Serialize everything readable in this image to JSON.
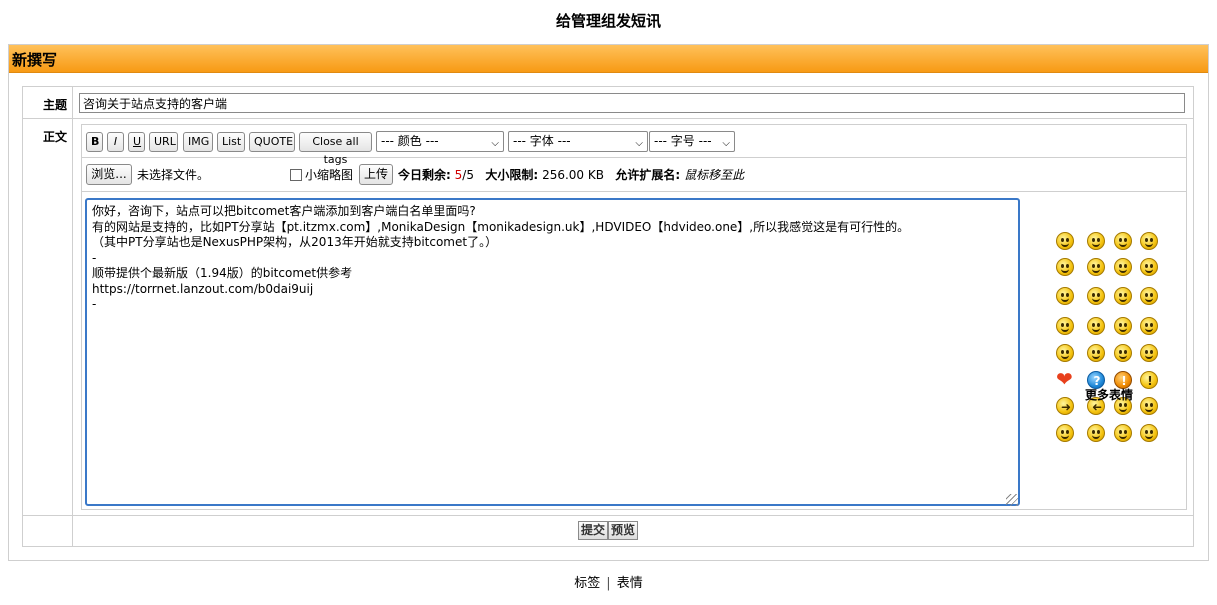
{
  "page_title": "给管理组发短讯",
  "section_header": "新撰写",
  "subject": {
    "label": "主题",
    "value": "咨询关于站点支持的客户端"
  },
  "body_label": "正文",
  "toolbar": {
    "bold": "B",
    "italic": "I",
    "underline": "U",
    "url": "URL",
    "img": "IMG",
    "list": "List",
    "quote": "QUOTE",
    "close_all_tags": "Close all tags",
    "color_select": "--- 颜色 ---",
    "font_select": "--- 字体 ---",
    "size_select": "--- 字号 ---"
  },
  "upload": {
    "browse_label": "浏览...",
    "no_file": "未选择文件。",
    "thumbnail_label": "小缩略图",
    "upload_label": "上传",
    "today_left_label": "今日剩余:",
    "today_left_used": "5",
    "today_left_total": "/5",
    "size_limit_label": "大小限制:",
    "size_limit_value": "256.00 KB",
    "allowed_ext_label": "允许扩展名:",
    "allowed_ext_value": "鼠标移至此"
  },
  "message_body": "你好，咨询下，站点可以把bitcomet客户端添加到客户端白名单里面吗?\n有的网站是支持的，比如PT分享站【pt.itzmx.com】,MonikaDesign【monikadesign.uk】,HDVIDEO【hdvideo.one】,所以我感觉这是有可行性的。\n（其中PT分享站也是NexusPHP架构，从2013年开始就支持bitcomet了。）\n-\n顺带提供个最新版（1.94版）的bitcomet供参考\nhttps://torrnet.lanzout.com/b0dai9uij\n-",
  "smilies": [
    "smile-icon",
    "grin-icon",
    "laugh-icon",
    "big-grin-icon",
    "tongue-icon",
    "wink-icon",
    "neutral-icon",
    "confused-icon",
    "sad-icon",
    "cry-icon",
    "shock-icon",
    "sleepy-icon",
    "angel-icon",
    "eyeroll-icon",
    "blush-icon",
    "cool-icon",
    "wave-icon",
    "angry-icon",
    "hmm-icon",
    "worried-icon",
    "heart-icon",
    "question-icon",
    "exclamation-icon",
    "idea-icon",
    "arrow-right-icon",
    "arrow-left-icon",
    "whistle-icon",
    "thinking-icon",
    "surprised-icon",
    "grin2-icon",
    "smirk-icon",
    "happy-icon"
  ],
  "more_smilies": "更多表情",
  "buttons": {
    "submit": "提交",
    "preview": "预览"
  },
  "footer": {
    "tags": "标签",
    "separator": "|",
    "smilies": "表情"
  }
}
